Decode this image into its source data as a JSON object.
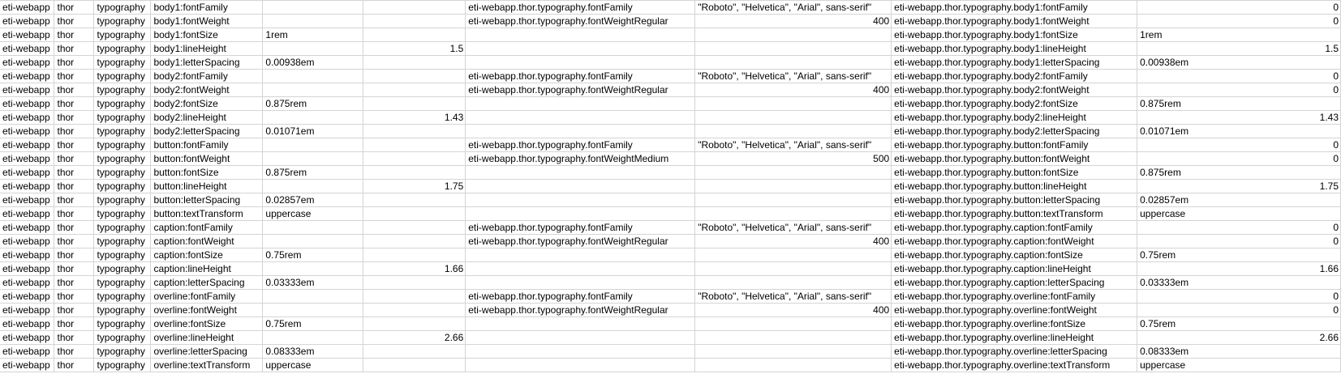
{
  "rows": [
    [
      "eti-webapp",
      "thor",
      "typography",
      "body1:fontFamily",
      "",
      "",
      "eti-webapp.thor.typography.fontFamily",
      "\"Roboto\", \"Helvetica\", \"Arial\", sans-serif\"",
      "eti-webapp.thor.typography.body1:fontFamily",
      "0"
    ],
    [
      "eti-webapp",
      "thor",
      "typography",
      "body1:fontWeight",
      "",
      "",
      "eti-webapp.thor.typography.fontWeightRegular",
      "400",
      "eti-webapp.thor.typography.body1:fontWeight",
      "0"
    ],
    [
      "eti-webapp",
      "thor",
      "typography",
      "body1:fontSize",
      "1rem",
      "",
      "",
      "",
      "eti-webapp.thor.typography.body1:fontSize",
      "1rem"
    ],
    [
      "eti-webapp",
      "thor",
      "typography",
      "body1:lineHeight",
      "",
      "1.5",
      "",
      "",
      "eti-webapp.thor.typography.body1:lineHeight",
      "1.5"
    ],
    [
      "eti-webapp",
      "thor",
      "typography",
      "body1:letterSpacing",
      "0.00938em",
      "",
      "",
      "",
      "eti-webapp.thor.typography.body1:letterSpacing",
      "0.00938em"
    ],
    [
      "eti-webapp",
      "thor",
      "typography",
      "body2:fontFamily",
      "",
      "",
      "eti-webapp.thor.typography.fontFamily",
      "\"Roboto\", \"Helvetica\", \"Arial\", sans-serif\"",
      "eti-webapp.thor.typography.body2:fontFamily",
      "0"
    ],
    [
      "eti-webapp",
      "thor",
      "typography",
      "body2:fontWeight",
      "",
      "",
      "eti-webapp.thor.typography.fontWeightRegular",
      "400",
      "eti-webapp.thor.typography.body2:fontWeight",
      "0"
    ],
    [
      "eti-webapp",
      "thor",
      "typography",
      "body2:fontSize",
      "0.875rem",
      "",
      "",
      "",
      "eti-webapp.thor.typography.body2:fontSize",
      "0.875rem"
    ],
    [
      "eti-webapp",
      "thor",
      "typography",
      "body2:lineHeight",
      "",
      "1.43",
      "",
      "",
      "eti-webapp.thor.typography.body2:lineHeight",
      "1.43"
    ],
    [
      "eti-webapp",
      "thor",
      "typography",
      "body2:letterSpacing",
      "0.01071em",
      "",
      "",
      "",
      "eti-webapp.thor.typography.body2:letterSpacing",
      "0.01071em"
    ],
    [
      "eti-webapp",
      "thor",
      "typography",
      "button:fontFamily",
      "",
      "",
      "eti-webapp.thor.typography.fontFamily",
      "\"Roboto\", \"Helvetica\", \"Arial\", sans-serif\"",
      "eti-webapp.thor.typography.button:fontFamily",
      "0"
    ],
    [
      "eti-webapp",
      "thor",
      "typography",
      "button:fontWeight",
      "",
      "",
      "eti-webapp.thor.typography.fontWeightMedium",
      "500",
      "eti-webapp.thor.typography.button:fontWeight",
      "0"
    ],
    [
      "eti-webapp",
      "thor",
      "typography",
      "button:fontSize",
      "0.875rem",
      "",
      "",
      "",
      "eti-webapp.thor.typography.button:fontSize",
      "0.875rem"
    ],
    [
      "eti-webapp",
      "thor",
      "typography",
      "button:lineHeight",
      "",
      "1.75",
      "",
      "",
      "eti-webapp.thor.typography.button:lineHeight",
      "1.75"
    ],
    [
      "eti-webapp",
      "thor",
      "typography",
      "button:letterSpacing",
      "0.02857em",
      "",
      "",
      "",
      "eti-webapp.thor.typography.button:letterSpacing",
      "0.02857em"
    ],
    [
      "eti-webapp",
      "thor",
      "typography",
      "button:textTransform",
      "uppercase",
      "",
      "",
      "",
      "eti-webapp.thor.typography.button:textTransform",
      "uppercase"
    ],
    [
      "eti-webapp",
      "thor",
      "typography",
      "caption:fontFamily",
      "",
      "",
      "eti-webapp.thor.typography.fontFamily",
      "\"Roboto\", \"Helvetica\", \"Arial\", sans-serif\"",
      "eti-webapp.thor.typography.caption:fontFamily",
      "0"
    ],
    [
      "eti-webapp",
      "thor",
      "typography",
      "caption:fontWeight",
      "",
      "",
      "eti-webapp.thor.typography.fontWeightRegular",
      "400",
      "eti-webapp.thor.typography.caption:fontWeight",
      "0"
    ],
    [
      "eti-webapp",
      "thor",
      "typography",
      "caption:fontSize",
      "0.75rem",
      "",
      "",
      "",
      "eti-webapp.thor.typography.caption:fontSize",
      "0.75rem"
    ],
    [
      "eti-webapp",
      "thor",
      "typography",
      "caption:lineHeight",
      "",
      "1.66",
      "",
      "",
      "eti-webapp.thor.typography.caption:lineHeight",
      "1.66"
    ],
    [
      "eti-webapp",
      "thor",
      "typography",
      "caption:letterSpacing",
      "0.03333em",
      "",
      "",
      "",
      "eti-webapp.thor.typography.caption:letterSpacing",
      "0.03333em"
    ],
    [
      "eti-webapp",
      "thor",
      "typography",
      "overline:fontFamily",
      "",
      "",
      "eti-webapp.thor.typography.fontFamily",
      "\"Roboto\", \"Helvetica\", \"Arial\", sans-serif\"",
      "eti-webapp.thor.typography.overline:fontFamily",
      "0"
    ],
    [
      "eti-webapp",
      "thor",
      "typography",
      "overline:fontWeight",
      "",
      "",
      "eti-webapp.thor.typography.fontWeightRegular",
      "400",
      "eti-webapp.thor.typography.overline:fontWeight",
      "0"
    ],
    [
      "eti-webapp",
      "thor",
      "typography",
      "overline:fontSize",
      "0.75rem",
      "",
      "",
      "",
      "eti-webapp.thor.typography.overline:fontSize",
      "0.75rem"
    ],
    [
      "eti-webapp",
      "thor",
      "typography",
      "overline:lineHeight",
      "",
      "2.66",
      "",
      "",
      "eti-webapp.thor.typography.overline:lineHeight",
      "2.66"
    ],
    [
      "eti-webapp",
      "thor",
      "typography",
      "overline:letterSpacing",
      "0.08333em",
      "",
      "",
      "",
      "eti-webapp.thor.typography.overline:letterSpacing",
      "0.08333em"
    ],
    [
      "eti-webapp",
      "thor",
      "typography",
      "overline:textTransform",
      "uppercase",
      "",
      "",
      "",
      "eti-webapp.thor.typography.overline:textTransform",
      "uppercase"
    ]
  ],
  "grid_color": "#d4d4d4"
}
